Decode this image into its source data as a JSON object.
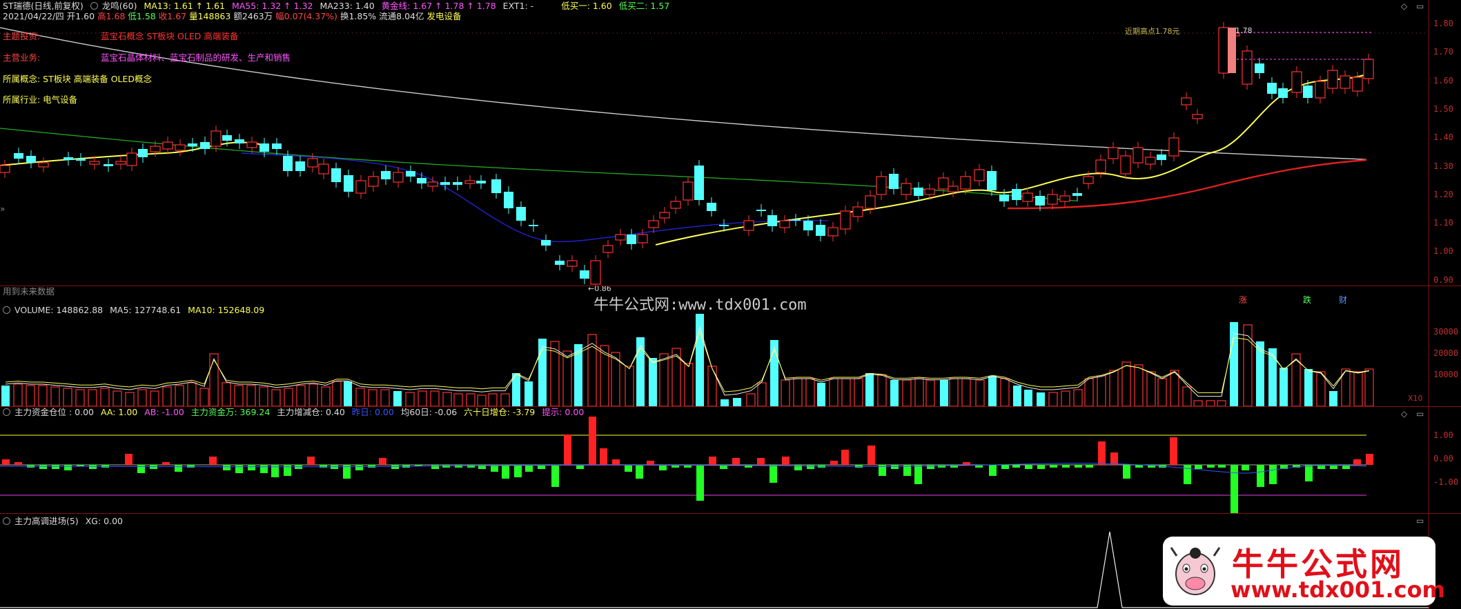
{
  "header": {
    "symbol": "ST瑞德(日线,前复权)",
    "indicator": "龙鸣(60)",
    "ma13": "MA13: 1.61 ↑ 1.61",
    "ma55": "MA55: 1.32 ↑ 1.32",
    "ma233": "MA233: 1.40",
    "golden": "黄金线: 1.67 ↑ 1.78 ↑ 1.78",
    "ext": "EXT1: -",
    "buy1": "低买一: 1.60",
    "buy2": "低买二: 1.57"
  },
  "quote": {
    "date": "2021/04/22/四 开1.60",
    "high": "高1.68",
    "low": "低1.58",
    "close": "收1.67",
    "vol": "量148863",
    "amount": "额2463万",
    "change": "幅0.07(4.37%)",
    "turnover": "换1.85%",
    "float": "流通8.04亿",
    "sector": "发电设备"
  },
  "info": {
    "topic_label": "主题投资:",
    "topic_value": "蓝宝石概念   ST板块   OLED   高端装备",
    "business_label": "主营业务:",
    "business_value": "蓝宝石晶体材料、蓝宝石制品的研发、生产和销售",
    "concept": "所属概念: ST板块 高端装备 OLED概念",
    "industry": "所属行业: 电气设备",
    "future": "用到未来数据"
  },
  "annotations": {
    "low_price": "←0.86",
    "high_price": "1.78",
    "prev_high": "近期高点1.78元",
    "zhang": "涨",
    "die": "跌",
    "cai": "财"
  },
  "watermark": "牛牛公式网:www.tdx001.com",
  "logo": {
    "cn": "牛牛公式网",
    "url": "www.tdx001.com"
  },
  "price_axis": [
    "1.80",
    "1.70",
    "1.60",
    "1.50",
    "1.40",
    "1.30",
    "1.20",
    "1.10",
    "1.00",
    "0.90"
  ],
  "volume": {
    "title": "VOLUME: 148862.88",
    "ma5": "MA5: 127748.61",
    "ma10": "MA10: 152648.09",
    "axis": [
      "30000",
      "20000",
      "10000"
    ],
    "unit": "X10"
  },
  "fund": {
    "title": "主力资金仓位 : 0.00",
    "aa": "AA: 1.00",
    "ab": "AB: -1.00",
    "amount": "主力资金万: 369.24",
    "change": "主力增减仓: 0.40",
    "prev": "昨日: 0.00",
    "avg60": "均60日: -0.06",
    "sixty": "六十日增仓: -3.79",
    "hint": "提示: 0.00",
    "axis": [
      "1.00",
      "0.00",
      "-1.00"
    ]
  },
  "signal": {
    "title": "主力高调进场(5)",
    "xg": "XG: 0.00"
  },
  "colors": {
    "up": "#ff3333",
    "down": "#54ffff",
    "ma13": "#ffff55",
    "ma55": "#1a1ad0",
    "ma233": "#cccccc",
    "green": "#22aa22",
    "red": "#e02020",
    "pink": "#ff55ff"
  }
}
